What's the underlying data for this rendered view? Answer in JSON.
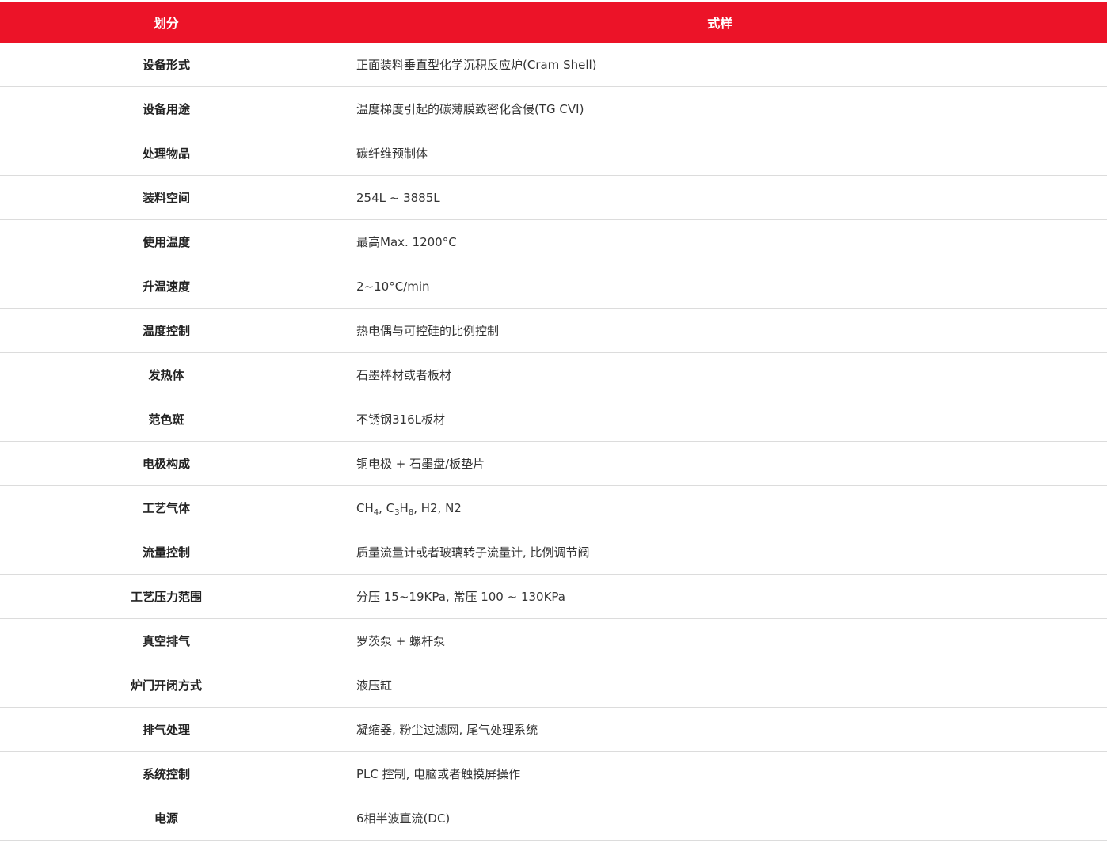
{
  "header": {
    "col1": "划分",
    "col2": "式样"
  },
  "colors": {
    "header_bg": "#ec1328",
    "header_text": "#ffffff",
    "row_divider": "#dcdcdc"
  },
  "rows": [
    {
      "label": "设备形式",
      "value": "正面装料垂直型化学沉积反应炉(Cram Shell)"
    },
    {
      "label": "设备用途",
      "value": "温度梯度引起的碳薄膜致密化含侵(TG CVI)"
    },
    {
      "label": "处理物品",
      "value": "碳纤维预制体"
    },
    {
      "label": "装料空间",
      "value": "254L ~ 3885L"
    },
    {
      "label": "使用温度",
      "value": "最高Max. 1200°C"
    },
    {
      "label": "升温速度",
      "value": "2~10°C/min"
    },
    {
      "label": "温度控制",
      "value": "热电偶与可控硅的比例控制"
    },
    {
      "label": "发热体",
      "value": "石墨棒材或者板材"
    },
    {
      "label": "范色斑",
      "value": "不锈钢316L板材"
    },
    {
      "label": "电极构成",
      "value": "铜电极 + 石墨盘/板垫片"
    },
    {
      "label": "工艺气体",
      "value_parts": {
        "ch": "CH",
        "ch_sub": "4",
        "sep1": ", C",
        "c_sub": "3",
        "h": "H",
        "h_sub": "8",
        "rest": ", H2, N2"
      }
    },
    {
      "label": "流量控制",
      "value": "质量流量计或者玻璃转子流量计, 比例调节阀"
    },
    {
      "label": "工艺压力范围",
      "value": "分压 15~19KPa, 常压 100 ~ 130KPa"
    },
    {
      "label": "真空排气",
      "value": "罗茨泵 + 螺杆泵"
    },
    {
      "label": "炉门开闭方式",
      "value": "液压缸"
    },
    {
      "label": "排气处理",
      "value": "凝缩器, 粉尘过滤网, 尾气处理系统"
    },
    {
      "label": "系统控制",
      "value": "PLC 控制, 电脑或者触摸屏操作"
    },
    {
      "label": "电源",
      "value": "6相半波直流(DC)"
    }
  ]
}
